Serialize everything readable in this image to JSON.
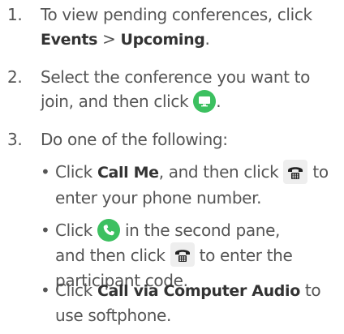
{
  "steps": [
    {
      "number": "1.",
      "text_a": "To view pending conferences, click",
      "events": "Events",
      "sep": ">",
      "upcoming": "Upcoming",
      "end": "."
    },
    {
      "number": "2.",
      "text_a": "Select the conference you want to",
      "text_b": "join, and then click",
      "end": ".",
      "icon": "join-video-icon"
    },
    {
      "number": "3.",
      "text_a": "Do one of the following:",
      "options": [
        {
          "bullet": "•",
          "prefix": "Click",
          "bold": "Call Me",
          "mid": ", and then click",
          "icon": "dialpad-icon",
          "suffix": "to",
          "line2": "enter your phone number."
        },
        {
          "bullet": "•",
          "prefix": "Click",
          "icon1": "phone-call-icon",
          "mid": "in the second pane,",
          "line2_prefix": "and then click",
          "icon2": "dialpad-icon",
          "line2_suffix": "to enter the",
          "line3": "participant code."
        },
        {
          "bullet": "•",
          "prefix": "Click",
          "bold": "Call via Computer Audio",
          "suffix": "to",
          "line2": "use softphone."
        }
      ]
    }
  ],
  "colors": {
    "text": "#555555",
    "bold_text": "#333333",
    "accent_green": "#3cc060",
    "icon_bg": "#eeeeee"
  }
}
